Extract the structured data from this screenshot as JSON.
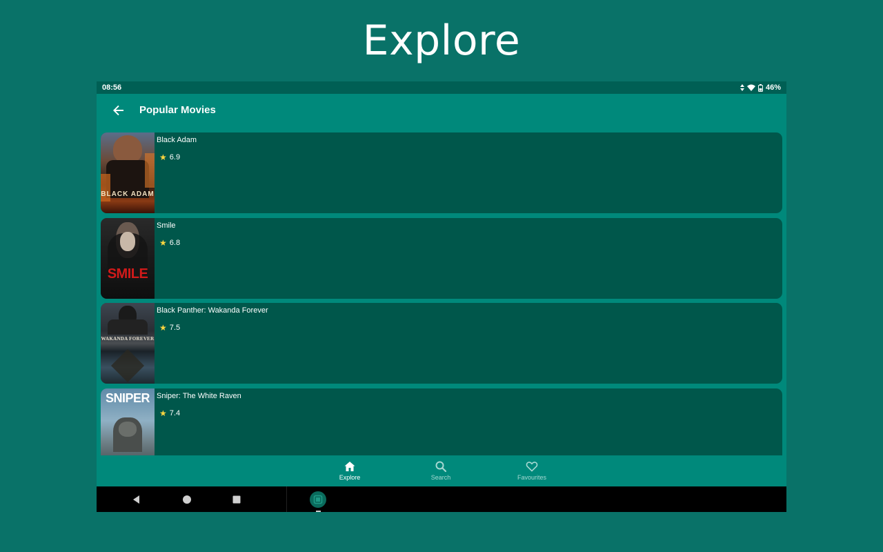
{
  "caption": "Explore",
  "status_bar": {
    "time": "08:56",
    "battery": "46%"
  },
  "app_bar": {
    "title": "Popular Movies",
    "back_icon": "arrow-back-icon"
  },
  "movies": [
    {
      "title": "Black Adam",
      "rating": "6.9",
      "poster_text": "BLACK ADAM"
    },
    {
      "title": "Smile",
      "rating": "6.8",
      "poster_text": "SMILE"
    },
    {
      "title": "Black Panther: Wakanda Forever",
      "rating": "7.5",
      "poster_text": "WAKANDA FOREVER"
    },
    {
      "title": "Sniper: The White Raven",
      "rating": "7.4",
      "poster_text": "SNIPER"
    }
  ],
  "bottom_nav": [
    {
      "label": "Explore",
      "icon": "home-icon",
      "active": true
    },
    {
      "label": "Search",
      "icon": "search-icon",
      "active": false
    },
    {
      "label": "Favourites",
      "icon": "heart-icon",
      "active": false
    }
  ],
  "colors": {
    "background": "#097268",
    "app_bar": "#00897b",
    "card": "#00574b",
    "status_bar": "#005f54",
    "star": "#ffd740"
  }
}
